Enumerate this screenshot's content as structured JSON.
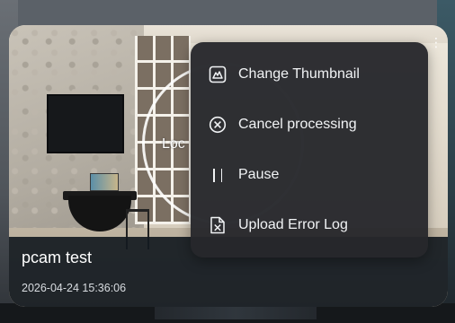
{
  "background": {
    "color": "#5b6168"
  },
  "card": {
    "overlay_text": "Loc",
    "title": "pcam test",
    "date": "2026-04-24 15:36:06"
  },
  "menu": {
    "items": [
      {
        "label": "Change Thumbnail",
        "icon": "image-icon"
      },
      {
        "label": "Cancel processing",
        "icon": "cancel-circle-icon"
      },
      {
        "label": "Pause",
        "icon": "pause-icon"
      },
      {
        "label": "Upload Error Log",
        "icon": "file-error-icon"
      }
    ]
  },
  "colors": {
    "menu_bg": "#26282c",
    "info_bar_bg": "#141a21",
    "text": "#ffffff"
  }
}
